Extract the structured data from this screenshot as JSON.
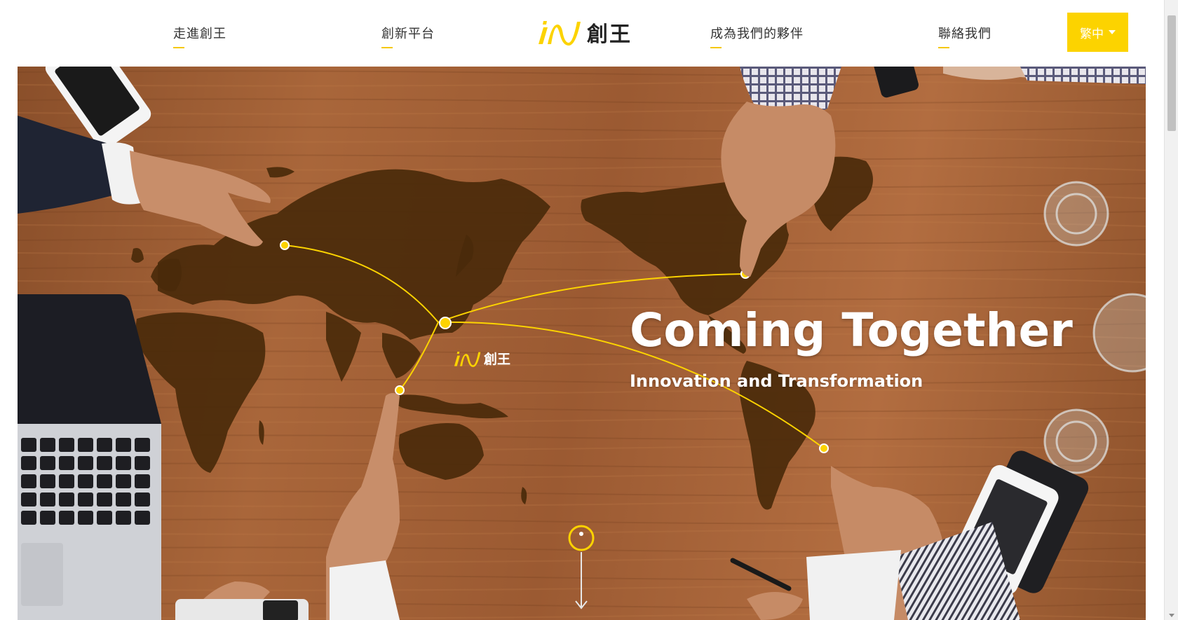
{
  "header": {
    "nav": [
      {
        "label": "走進創王"
      },
      {
        "label": "創新平台"
      },
      {
        "label": "成為我們的夥伴"
      },
      {
        "label": "聯絡我們"
      }
    ],
    "logo_text": "創王",
    "language_label": "繁中"
  },
  "hero": {
    "title": "Coming Together",
    "subtitle": "Innovation and Transformation",
    "map_logo_text": "創王"
  },
  "colors": {
    "accent": "#fcd300",
    "map": "#4a2a0a",
    "wood": "#a0603a"
  },
  "icons": {
    "logo": "logo-mark-icon",
    "language_caret": "caret-down-icon",
    "scroll_down": "scroll-down-arrow-icon"
  }
}
